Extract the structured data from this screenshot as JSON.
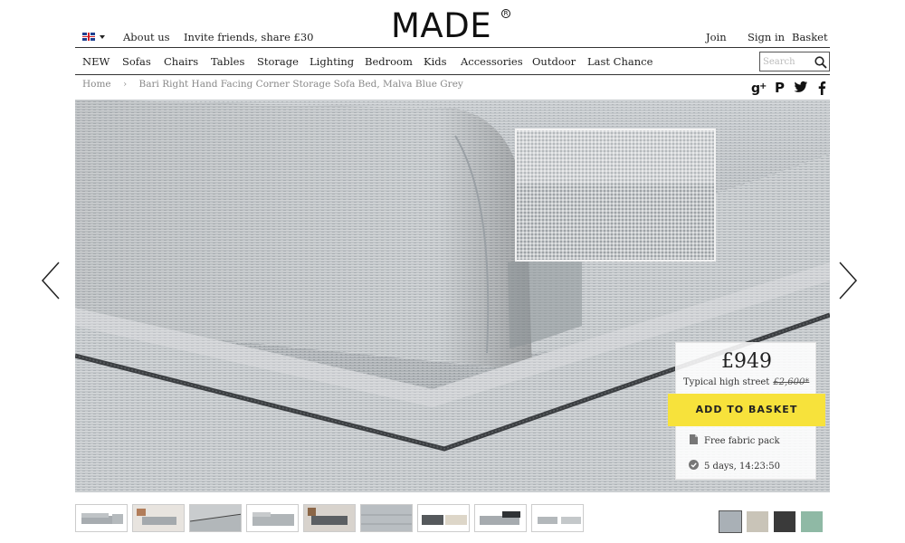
{
  "header": {
    "logo": "MADE",
    "about": "About us",
    "invite": "Invite friends, share £30",
    "join": "Join",
    "sign_in": "Sign in",
    "basket": "Basket"
  },
  "nav": {
    "items": [
      "NEW",
      "Sofas",
      "Chairs",
      "Tables",
      "Storage",
      "Lighting",
      "Bedroom",
      "Kids",
      "Accessories",
      "Outdoor",
      "Last Chance"
    ],
    "search_placeholder": "Search"
  },
  "breadcrumb": {
    "home": "Home",
    "separator": "›",
    "current": "Bari Right Hand Facing Corner Storage Sofa Bed, Malva Blue Grey"
  },
  "social": [
    "google-plus-icon",
    "pinterest-icon",
    "twitter-icon",
    "facebook-icon"
  ],
  "product": {
    "price": "£949",
    "typical_label": "Typical high street",
    "typical_price": "£2,600*",
    "add_to_basket": "ADD TO BASKET",
    "fabric_pack": "Free fabric pack",
    "countdown": "5 days, 14:23:50"
  },
  "thumbnails_count": 9,
  "swatch_colors": [
    "#a9b0b6",
    "#c9c4b8",
    "#3a3a3a",
    "#8fb9a5"
  ],
  "colors": {
    "accent_button": "#f7e23b",
    "text": "#222222"
  }
}
